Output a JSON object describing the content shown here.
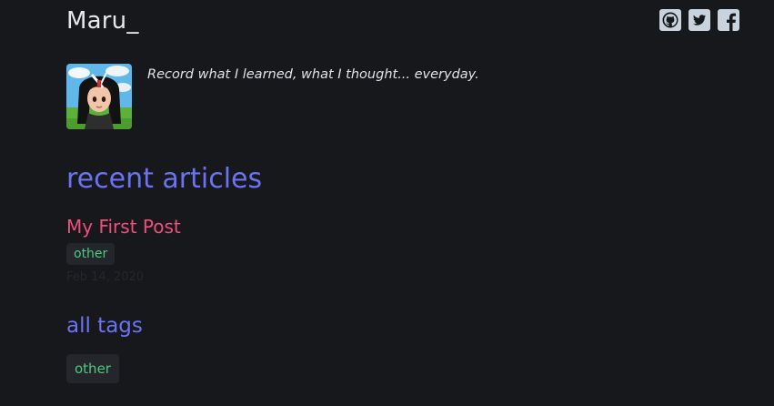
{
  "site": {
    "title": "Maru_",
    "tagline": "Record what I learned, what I thought... everyday."
  },
  "social": [
    {
      "name": "github-icon",
      "label": "GitHub"
    },
    {
      "name": "twitter-icon",
      "label": "Twitter"
    },
    {
      "name": "facebook-icon",
      "label": "Facebook"
    }
  ],
  "recent": {
    "heading": "recent articles",
    "posts": [
      {
        "title": "My First Post",
        "tag": "other",
        "date": "Feb 14, 2020"
      }
    ]
  },
  "tags": {
    "heading": "all tags",
    "items": [
      "other"
    ]
  },
  "colors": {
    "background": "#17181c",
    "heading": "#6b73f5",
    "post_title": "#ef4f7d",
    "tag_text": "#4cc97d",
    "tag_bg": "#24262b",
    "icon": "#c9d3de"
  }
}
